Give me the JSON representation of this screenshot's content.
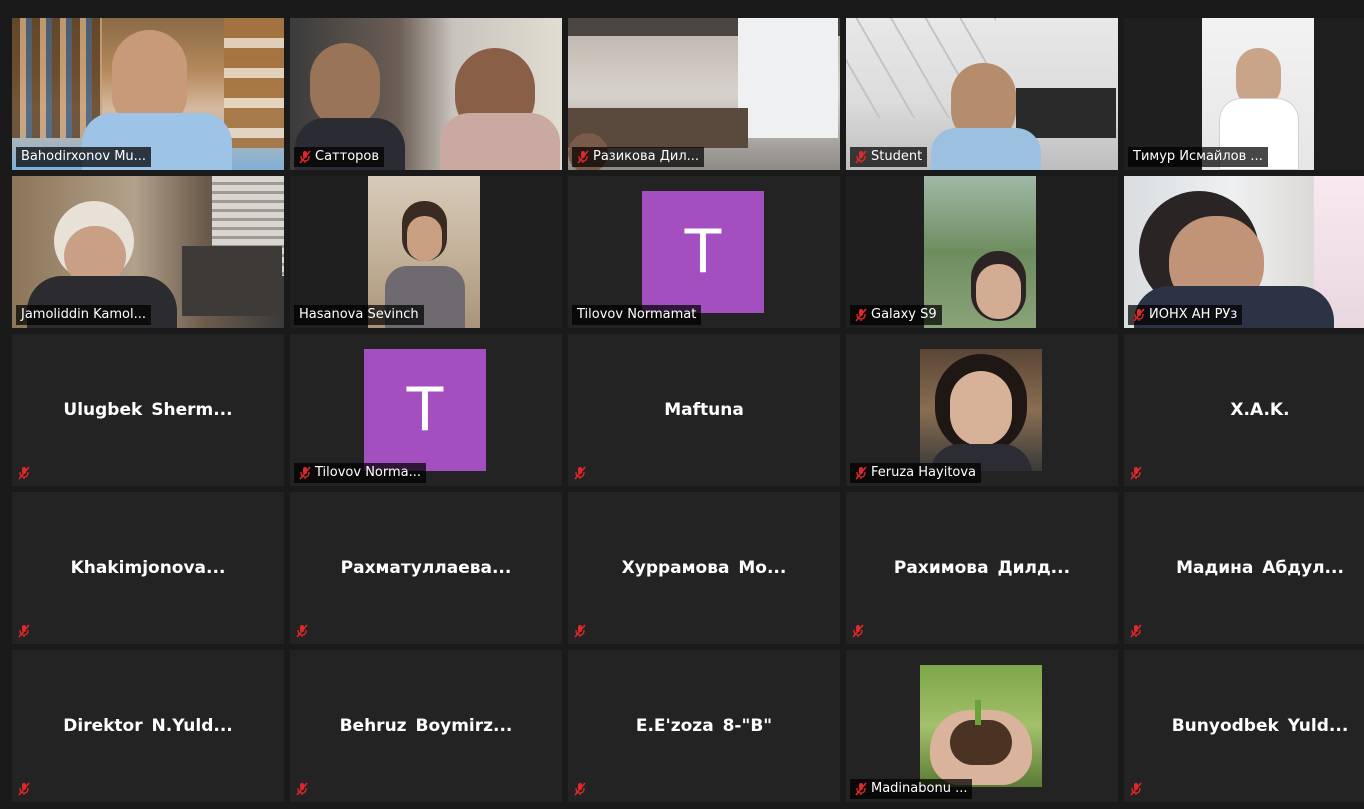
{
  "participants": [
    {
      "name": "Bahodirxonov Mu...",
      "muted": false
    },
    {
      "name": "Сатторов",
      "muted": true
    },
    {
      "name": "Разикова Дил...",
      "muted": true
    },
    {
      "name": "Student",
      "muted": true
    },
    {
      "name": "Тимур Исмайлов ...",
      "muted": false
    },
    {
      "name": "Jamoliddin Kamol...",
      "muted": false
    },
    {
      "name": "Hasanova Sevinch",
      "muted": false
    },
    {
      "name": "Tilovov Normamat",
      "muted": false,
      "avatar_letter": "T"
    },
    {
      "name": "Galaxy S9",
      "muted": true
    },
    {
      "name": "ИОНХ АН РУз",
      "muted": true
    },
    {
      "name": "Ulugbek Sherm...",
      "muted": true
    },
    {
      "name": "Tilovov Norma...",
      "muted": true,
      "avatar_letter": "T"
    },
    {
      "name": "Maftuna",
      "muted": true
    },
    {
      "name": "Feruza Hayitova",
      "muted": true
    },
    {
      "name": "X.A.K.",
      "muted": true
    },
    {
      "name": "Khakimjonova...",
      "muted": true
    },
    {
      "name": "Рахматуллаева...",
      "muted": true
    },
    {
      "name": "Хуррамова Мо...",
      "muted": true
    },
    {
      "name": "Рахимова Дилд...",
      "muted": true
    },
    {
      "name": "Мадина Абдул...",
      "muted": true
    },
    {
      "name": "Direktor N.Yuld...",
      "muted": true
    },
    {
      "name": "Behruz Boymirz...",
      "muted": true
    },
    {
      "name": "E.E'zoza 8-\"B\"",
      "muted": true
    },
    {
      "name": "Madinabonu ...",
      "muted": true
    },
    {
      "name": "Bunyodbek Yuld...",
      "muted": true
    }
  ],
  "colors": {
    "active_speaker_border": "#c8e35c",
    "avatar_bg": "#a44fc0",
    "mute_red": "#e02828",
    "tile_bg": "#232323"
  }
}
